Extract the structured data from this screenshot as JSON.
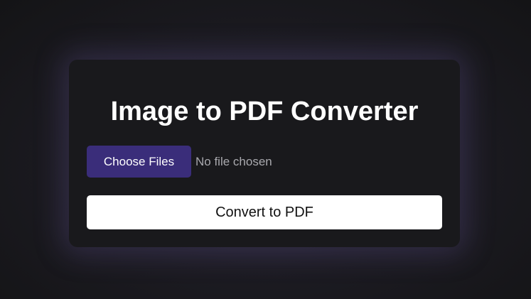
{
  "converter": {
    "title": "Image to PDF Converter",
    "choose_files_label": "Choose Files",
    "file_status": "No file chosen",
    "convert_label": "Convert to PDF"
  },
  "colors": {
    "accent": "#3a2d7a",
    "card_background": "#19191c",
    "page_background": "#18181b",
    "convert_button": "#ffffff"
  }
}
